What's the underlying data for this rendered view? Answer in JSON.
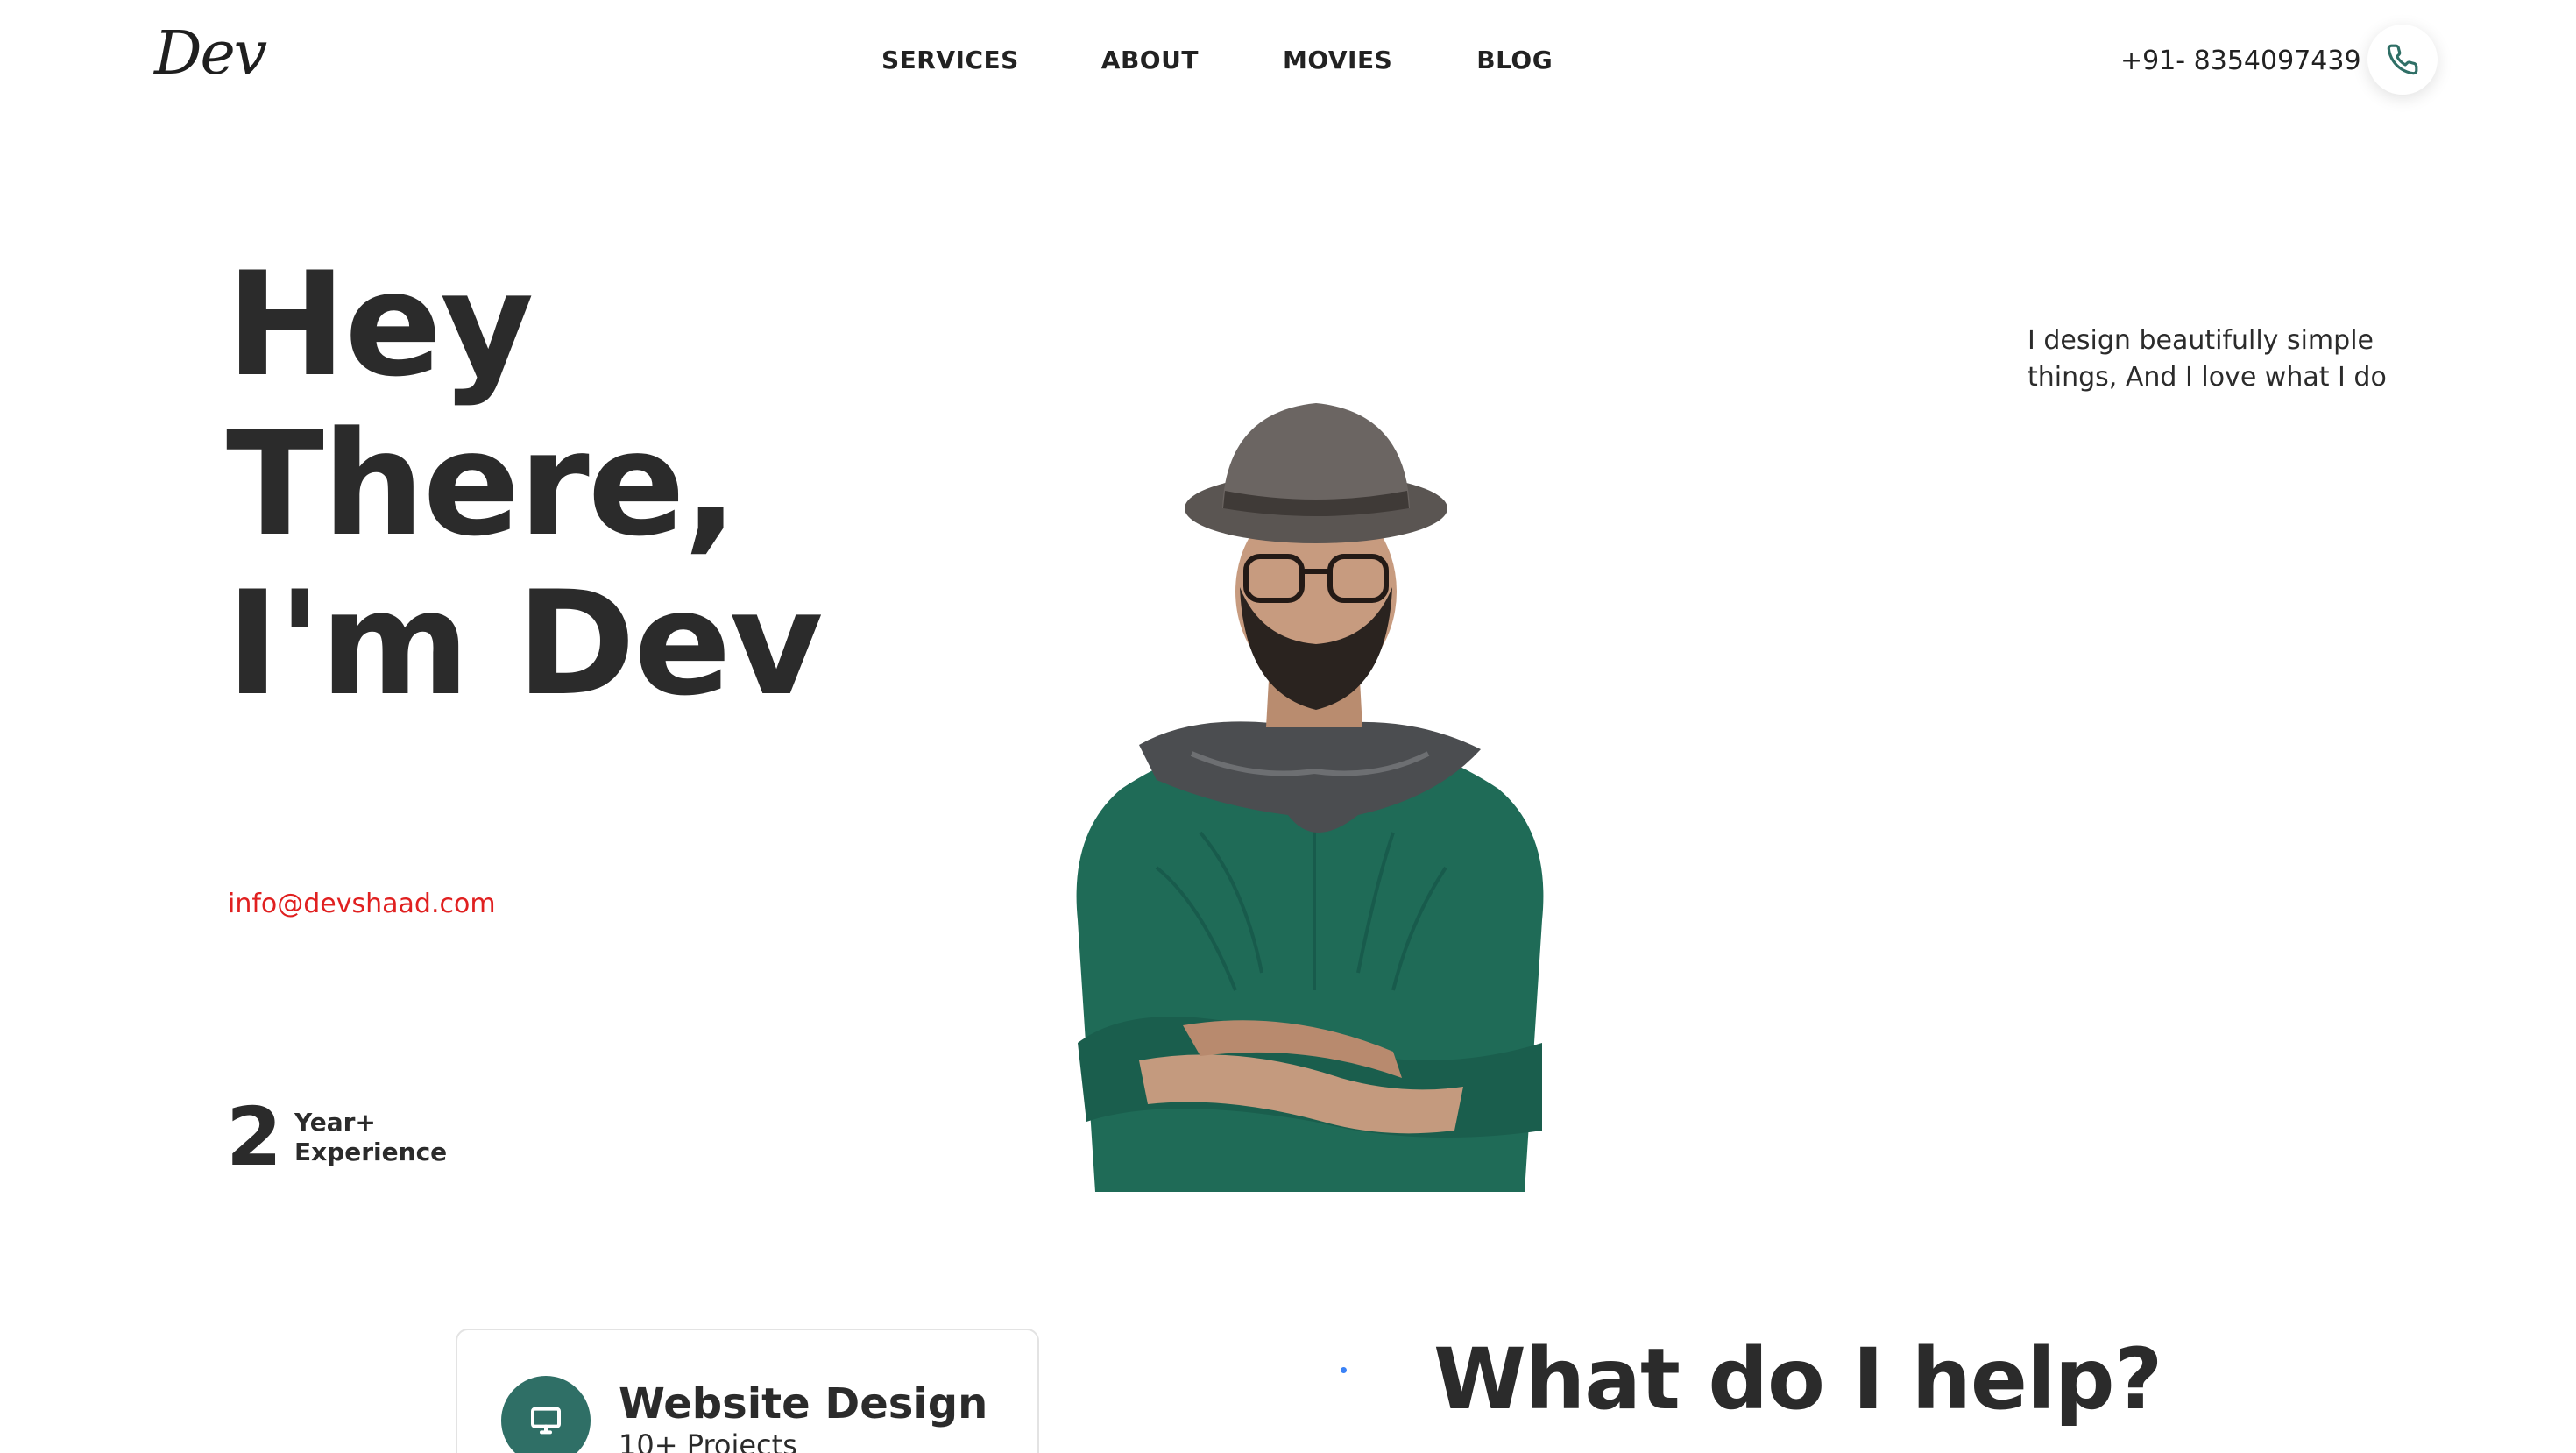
{
  "header": {
    "logo": "Dev",
    "nav": [
      "SERVICES",
      "ABOUT",
      "MOVIES",
      "BLOG"
    ],
    "phone": "+91- 8354097439"
  },
  "hero": {
    "title_lines": [
      "Hey",
      "There,",
      "I'm Dev"
    ],
    "email": "info@devshaad.com",
    "experience_number": "2",
    "experience_label_1": "Year+",
    "experience_label_2": "Experience",
    "tagline": "I design beautifully simple things, And I love what I do"
  },
  "services": {
    "card_title": "Website Design",
    "card_subtitle": "10+ Projects",
    "section_title": "What do I help?"
  },
  "colors": {
    "accent_green": "#2f6f66",
    "email_red": "#e02020",
    "text_dark": "#2b2b2b"
  }
}
